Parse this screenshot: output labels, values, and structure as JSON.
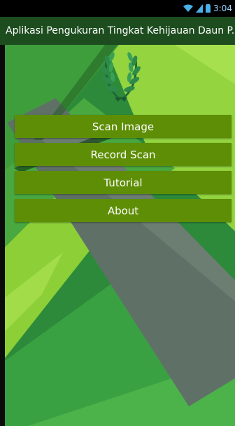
{
  "status_bar": {
    "time": "3:04",
    "icons": [
      "wifi-icon",
      "signal-icon",
      "battery-icon"
    ]
  },
  "app_bar": {
    "title": "Aplikasi Pengukuran Tingkat Kehijauan Daun P..."
  },
  "logo": {
    "icon": "laurel-wreath-icon"
  },
  "menu": {
    "items": [
      {
        "label": "Scan Image"
      },
      {
        "label": "Record Scan"
      },
      {
        "label": "Tutorial"
      },
      {
        "label": "About"
      }
    ]
  },
  "colors": {
    "app_bar": "#1d4d1f",
    "button": "#5e8e06",
    "background_green": "#2f8a3a",
    "light_green": "#9bdc45",
    "gray_band": "#62746a"
  }
}
